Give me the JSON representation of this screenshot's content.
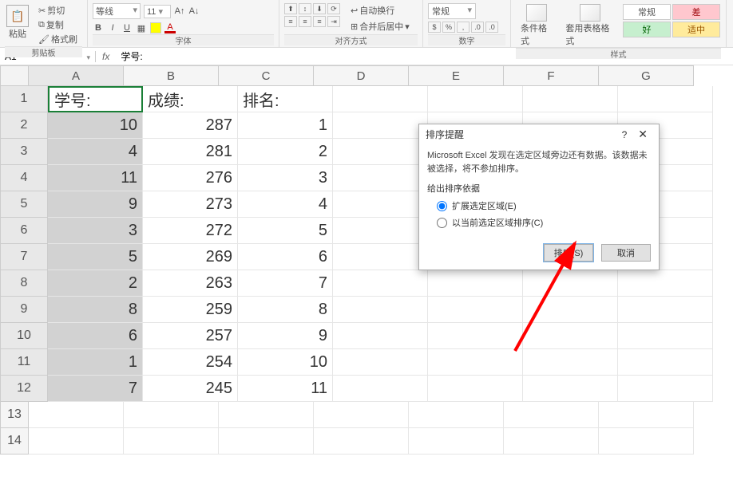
{
  "ribbon": {
    "clipboard": {
      "label": "剪贴板",
      "cut": "剪切",
      "copy": "复制",
      "format_painter": "格式刷",
      "paste": "粘贴"
    },
    "font": {
      "label": "字体",
      "family": "等线",
      "size": "11",
      "bold": "B",
      "italic": "I",
      "underline": "U"
    },
    "alignment": {
      "label": "对齐方式",
      "wrap": "自动换行",
      "merge": "合并后居中"
    },
    "number": {
      "label": "数字",
      "format": "常规"
    },
    "cond_format": "条件格式",
    "table_format": "套用表格格式",
    "styles": {
      "label": "样式",
      "normal": "常规",
      "good": "好",
      "bad": "差",
      "neutral": "适中"
    }
  },
  "namebox": "A1",
  "formula": "学号:",
  "columns": [
    "A",
    "B",
    "C",
    "D",
    "E",
    "F",
    "G"
  ],
  "headers": {
    "A": "学号:",
    "B": "成绩:",
    "C": "排名:"
  },
  "data": [
    {
      "A": "10",
      "B": "287",
      "C": "1"
    },
    {
      "A": "4",
      "B": "281",
      "C": "2"
    },
    {
      "A": "11",
      "B": "276",
      "C": "3"
    },
    {
      "A": "9",
      "B": "273",
      "C": "4"
    },
    {
      "A": "3",
      "B": "272",
      "C": "5"
    },
    {
      "A": "5",
      "B": "269",
      "C": "6"
    },
    {
      "A": "2",
      "B": "263",
      "C": "7"
    },
    {
      "A": "8",
      "B": "259",
      "C": "8"
    },
    {
      "A": "6",
      "B": "257",
      "C": "9"
    },
    {
      "A": "1",
      "B": "254",
      "C": "10"
    },
    {
      "A": "7",
      "B": "245",
      "C": "11"
    }
  ],
  "dialog": {
    "title": "排序提醒",
    "message": "Microsoft Excel 发现在选定区域旁边还有数据。该数据未被选择，将不参加排序。",
    "section": "给出排序依据",
    "opt_expand": "扩展选定区域(E)",
    "opt_current": "以当前选定区域排序(C)",
    "sort": "排序(S)",
    "cancel": "取消"
  }
}
